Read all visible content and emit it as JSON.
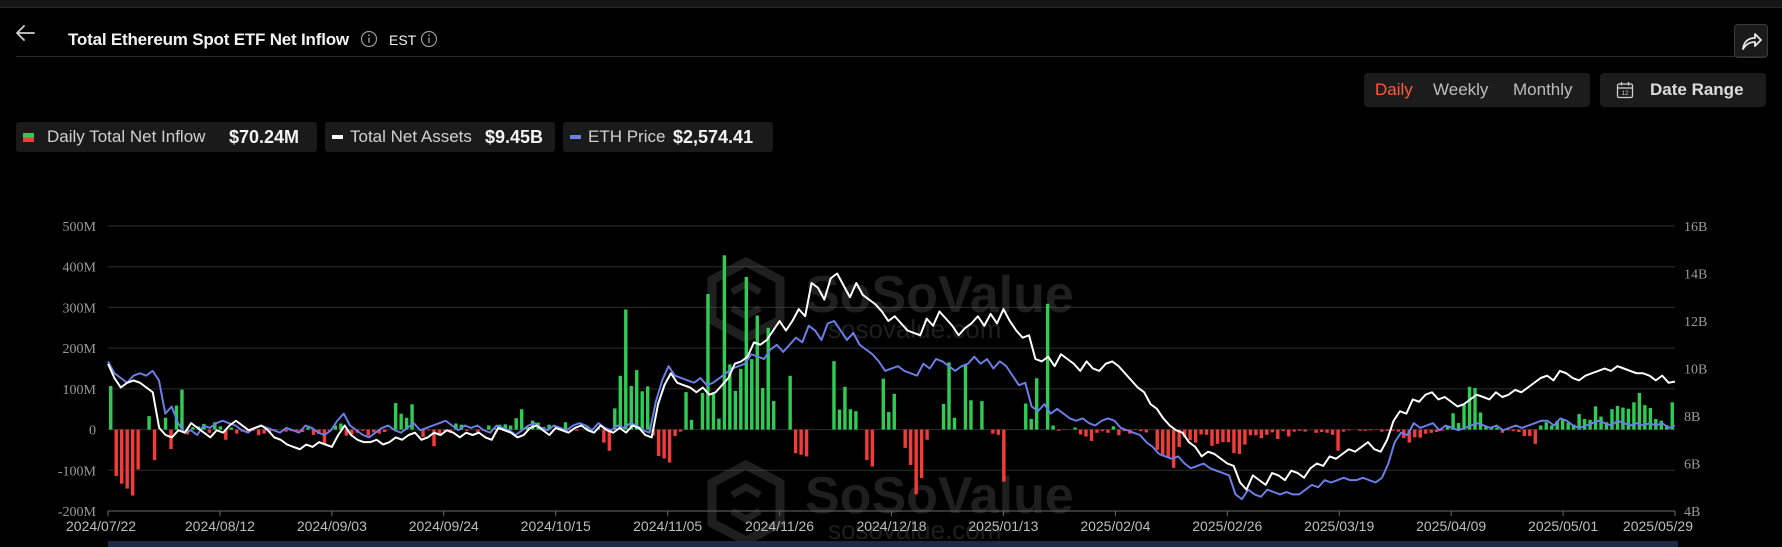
{
  "header": {
    "title": "Total Ethereum Spot ETF Net Inflow",
    "timezone": "EST"
  },
  "period_tabs": [
    {
      "label": "Daily",
      "active": true
    },
    {
      "label": "Weekly",
      "active": false
    },
    {
      "label": "Monthly",
      "active": false
    }
  ],
  "date_range_label": "Date Range",
  "legend": [
    {
      "label": "Daily Total Net Inflow",
      "value": "$70.24M",
      "icon": "green-red-bar-swatch"
    },
    {
      "label": "Total Net Assets",
      "value": "$9.45B",
      "icon": "white-line-swatch"
    },
    {
      "label": "ETH Price",
      "value": "$2,574.41",
      "icon": "blue-line-swatch"
    }
  ],
  "watermark": {
    "brand": "SoSoValue",
    "site": "sosovalue.com"
  },
  "colors": {
    "inflow_positive": "#2ecc55",
    "inflow_negative": "#f23b3b",
    "total_net_assets": "#ffffff",
    "eth_price": "#6b7fe8",
    "active_tab": "#ff5a3c"
  },
  "chart_data": {
    "type": "bar",
    "left_axis": {
      "ticks": [
        "500M",
        "400M",
        "300M",
        "200M",
        "100M",
        "0",
        "-100M",
        "-200M"
      ],
      "range": [
        -200,
        500
      ],
      "unit": "M"
    },
    "right_axis": {
      "ticks": [
        "16B",
        "14B",
        "12B",
        "10B",
        "8B",
        "6B",
        "4B"
      ],
      "range": [
        4,
        16
      ],
      "unit": "B"
    },
    "x_tick_labels": [
      "2024/07/22",
      "2024/08/12",
      "2024/09/03",
      "2024/09/24",
      "2024/10/15",
      "2024/11/05",
      "2024/11/26",
      "2024/12/18",
      "2025/01/13",
      "2025/02/04",
      "2025/02/26",
      "2025/03/19",
      "2025/04/09",
      "2025/05/01",
      "2025/05/29"
    ],
    "grid": true,
    "series": [
      {
        "name": "Daily Total Net Inflow",
        "type": "bar",
        "axis": "left",
        "values": [
          107,
          -114,
          -133,
          -145,
          -162,
          -98,
          0,
          33,
          -75,
          0,
          29,
          -48,
          59,
          98,
          -12,
          6,
          8,
          14,
          -8,
          18,
          8,
          -25,
          5,
          -10,
          -5,
          -7,
          -3,
          -14,
          -10,
          -7,
          -3,
          0,
          -5,
          -4,
          -4,
          -6,
          5,
          -13,
          -11,
          -37,
          -5,
          10,
          15,
          -15,
          -12,
          -8,
          -3,
          -15,
          -7,
          -10,
          -6,
          0,
          65,
          39,
          29,
          62,
          0,
          -18,
          -2,
          -41,
          -15,
          -4,
          -8,
          15,
          12,
          -3,
          0,
          -8,
          -3,
          10,
          4,
          12,
          13,
          10,
          28,
          50,
          7,
          22,
          17,
          6,
          12,
          0,
          0,
          18,
          -5,
          -3,
          0,
          9,
          0,
          3,
          -32,
          -52,
          52,
          132,
          295,
          107,
          146,
          94,
          106,
          -15,
          -65,
          -71,
          -81,
          -16,
          -5,
          92,
          24,
          0,
          90,
          333,
          91,
          27,
          428,
          160,
          95,
          149,
          375,
          173,
          280,
          102,
          250,
          70,
          0,
          0,
          132,
          -58,
          -62,
          -66,
          0,
          0,
          0,
          0,
          168,
          49,
          105,
          50,
          45,
          0,
          -75,
          -91,
          0,
          125,
          43,
          88,
          0,
          -45,
          -87,
          -159,
          -119,
          -25,
          0,
          0,
          63,
          165,
          29,
          0,
          159,
          72,
          0,
          70,
          0,
          -10,
          -13,
          -128,
          0,
          0,
          0,
          64,
          26,
          126,
          0,
          309,
          10,
          -3,
          -1,
          0,
          5,
          -12,
          -17,
          -28,
          -8,
          -4,
          -8,
          8,
          -14,
          -4,
          -10,
          -1,
          -4,
          -7,
          0,
          -50,
          -62,
          -69,
          -94,
          -43,
          -19,
          -26,
          -32,
          -12,
          -13,
          -40,
          -35,
          -31,
          -31,
          -58,
          -60,
          -37,
          -14,
          -14,
          -21,
          -13,
          -7,
          -23,
          -4,
          -17,
          -5,
          -3,
          -5,
          0,
          -8,
          -6,
          -8,
          -13,
          -52,
          -5,
          -2,
          0,
          -3,
          -3,
          -2,
          -1,
          -5,
          -3,
          -3,
          -5,
          -21,
          -32,
          -19,
          -20,
          -10,
          -8,
          -6,
          -3,
          10,
          40,
          16,
          62,
          105,
          102,
          42,
          8,
          4,
          5,
          -8,
          -2,
          -4,
          -6,
          -16,
          -16,
          -35,
          10,
          18,
          10,
          21,
          24,
          17,
          12,
          38,
          26,
          24,
          57,
          32,
          18,
          50,
          58,
          54,
          51,
          67,
          90,
          60,
          53,
          26,
          22,
          11,
          67
        ]
      },
      {
        "name": "Total Net Assets",
        "type": "line",
        "axis": "right",
        "values": [
          10.2,
          9.6,
          9.2,
          9.4,
          9.5,
          9.4,
          9.2,
          9.0,
          7.5,
          7.2,
          7.1,
          7.4,
          7.3,
          7.7,
          7.5,
          7.3,
          7.1,
          7.4,
          7.3,
          7.6,
          7.8,
          7.6,
          7.4,
          7.5,
          7.6,
          7.4,
          7.1,
          7.0,
          6.8,
          6.7,
          6.6,
          6.8,
          6.7,
          6.9,
          6.8,
          6.7,
          7.2,
          7.6,
          7.2,
          7.0,
          6.9,
          6.9,
          7.0,
          6.8,
          6.9,
          7.1,
          7.0,
          7.2,
          7.3,
          7.0,
          7.1,
          7.3,
          7.2,
          7.4,
          7.3,
          7.1,
          7.3,
          7.2,
          7.3,
          7.1,
          7.0,
          7.5,
          7.4,
          7.3,
          7.1,
          7.2,
          7.5,
          7.6,
          7.4,
          7.2,
          7.5,
          7.4,
          7.3,
          7.5,
          7.6,
          7.4,
          7.3,
          7.6,
          7.4,
          7.3,
          7.5,
          7.3,
          7.6,
          7.5,
          7.2,
          7.1,
          8.5,
          9.3,
          9.8,
          9.4,
          9.3,
          9.2,
          9.0,
          9.2,
          8.9,
          9.0,
          9.3,
          9.6,
          10.2,
          10.3,
          10.5,
          11.1,
          11.0,
          11.2,
          11.6,
          12.0,
          11.6,
          12.0,
          12.5,
          12.2,
          13.6,
          13.4,
          12.9,
          13.8,
          14.0,
          13.5,
          13.0,
          13.6,
          13.1,
          12.9,
          12.7,
          12.4,
          12.0,
          12.2,
          11.9,
          11.6,
          11.5,
          11.4,
          12.1,
          11.8,
          12.4,
          12.1,
          11.8,
          11.4,
          11.7,
          11.9,
          12.2,
          11.8,
          12.3,
          11.9,
          12.5,
          12.0,
          11.6,
          11.3,
          11.4,
          10.4,
          10.3,
          10.5,
          10.1,
          10.6,
          10.4,
          10.2,
          9.9,
          10.3,
          10.0,
          9.9,
          10.2,
          10.3,
          10.1,
          9.8,
          9.5,
          9.2,
          9.0,
          8.5,
          8.3,
          7.9,
          7.6,
          7.4,
          7.3,
          6.9,
          6.7,
          6.3,
          6.5,
          6.4,
          6.2,
          6.0,
          5.9,
          5.2,
          4.9,
          5.5,
          5.3,
          5.1,
          5.6,
          5.5,
          5.3,
          5.7,
          5.6,
          5.4,
          5.8,
          6.0,
          5.9,
          6.3,
          6.2,
          6.4,
          6.6,
          6.5,
          6.7,
          6.9,
          6.6,
          6.5,
          7.0,
          7.8,
          8.2,
          8.1,
          8.7,
          8.6,
          8.9,
          9.0,
          8.7,
          8.8,
          8.6,
          8.4,
          8.5,
          8.7,
          8.9,
          8.8,
          8.7,
          9.0,
          8.8,
          8.9,
          9.1,
          9.0,
          9.2,
          9.4,
          9.6,
          9.7,
          9.5,
          9.9,
          9.8,
          9.6,
          9.5,
          9.7,
          9.8,
          9.9,
          10.0,
          9.9,
          10.1,
          10.0,
          9.9,
          9.8,
          9.8,
          9.7,
          9.5,
          9.7,
          9.4,
          9.45
        ]
      },
      {
        "name": "ETH Price",
        "type": "line",
        "axis": "right",
        "values": [
          10.3,
          9.8,
          9.6,
          9.4,
          9.7,
          9.8,
          9.7,
          9.9,
          9.5,
          8.1,
          8.4,
          7.7,
          7.3,
          7.4,
          7.2,
          7.6,
          7.5,
          7.7,
          7.8,
          7.7,
          7.6,
          7.4,
          7.3,
          7.5,
          7.6,
          7.5,
          7.4,
          7.3,
          7.5,
          7.4,
          7.3,
          7.6,
          7.5,
          7.3,
          7.2,
          7.4,
          7.8,
          8.1,
          7.6,
          7.4,
          7.2,
          7.1,
          7.3,
          7.5,
          7.6,
          7.4,
          7.3,
          7.5,
          7.7,
          7.4,
          7.5,
          7.6,
          7.7,
          7.8,
          7.6,
          7.4,
          7.6,
          7.5,
          7.6,
          7.4,
          7.3,
          7.6,
          7.5,
          7.4,
          7.2,
          7.4,
          7.6,
          7.7,
          7.5,
          7.4,
          7.6,
          7.5,
          7.4,
          7.6,
          7.7,
          7.6,
          7.4,
          7.7,
          7.5,
          7.4,
          7.6,
          7.5,
          7.7,
          7.6,
          7.4,
          7.3,
          8.6,
          9.5,
          10.1,
          9.7,
          9.6,
          9.5,
          9.4,
          9.6,
          9.3,
          9.4,
          9.6,
          9.8,
          10.0,
          10.1,
          10.2,
          10.6,
          10.5,
          10.4,
          10.8,
          11.0,
          10.7,
          11.0,
          11.3,
          11.1,
          11.8,
          11.6,
          11.2,
          11.9,
          12.0,
          11.6,
          11.2,
          11.5,
          11.0,
          10.8,
          10.6,
          10.3,
          9.9,
          10.0,
          10.1,
          9.9,
          9.8,
          9.7,
          10.2,
          10.0,
          10.4,
          10.3,
          10.1,
          9.9,
          10.1,
          10.2,
          10.5,
          10.2,
          10.4,
          10.0,
          10.3,
          10.1,
          9.7,
          9.3,
          9.4,
          8.4,
          8.2,
          8.5,
          8.1,
          8.3,
          8.1,
          7.9,
          7.8,
          7.9,
          7.7,
          7.6,
          7.8,
          7.9,
          7.8,
          7.5,
          7.4,
          7.3,
          7.2,
          6.9,
          6.7,
          6.4,
          6.3,
          6.2,
          6.3,
          6.0,
          5.8,
          5.9,
          6.0,
          5.8,
          5.7,
          5.6,
          5.5,
          4.7,
          4.5,
          4.9,
          4.7,
          4.6,
          4.9,
          4.8,
          4.7,
          4.8,
          4.7,
          4.7,
          4.9,
          5.1,
          5.0,
          5.3,
          5.2,
          5.3,
          5.4,
          5.3,
          5.3,
          5.4,
          5.3,
          5.2,
          5.4,
          6.0,
          6.9,
          7.3,
          7.2,
          7.7,
          7.5,
          7.6,
          7.7,
          7.4,
          7.6,
          7.5,
          7.4,
          7.5,
          7.6,
          7.7,
          7.6,
          7.5,
          7.6,
          7.4,
          7.5,
          7.6,
          7.5,
          7.6,
          7.7,
          7.8,
          7.8,
          7.6,
          7.9,
          7.8,
          7.6,
          7.5,
          7.6,
          7.7,
          7.8,
          7.7,
          7.6,
          7.8,
          7.7,
          7.6,
          7.7,
          7.6,
          7.7,
          7.6,
          7.7,
          7.5,
          7.6
        ]
      }
    ]
  }
}
